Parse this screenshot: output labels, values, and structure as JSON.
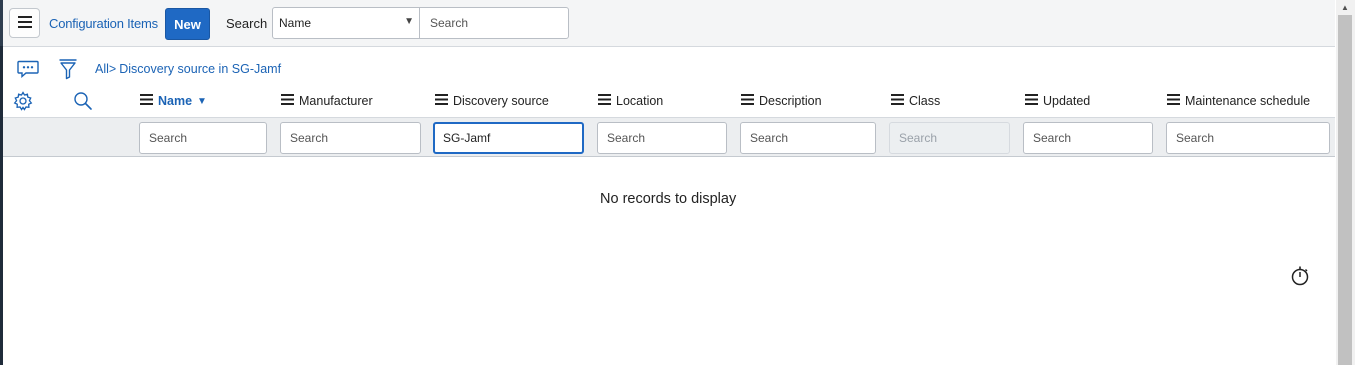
{
  "header": {
    "title": "Configuration Items",
    "new_label": "New",
    "search_label": "Search",
    "field_select_value": "Name",
    "search_placeholder": "Search"
  },
  "breadcrumb": {
    "root": "All",
    "separator": ">",
    "filter": "Discovery source in SG-Jamf"
  },
  "columns": [
    {
      "label": "Name",
      "sorted": "desc",
      "search_placeholder": "Search",
      "search_value": ""
    },
    {
      "label": "Manufacturer",
      "search_placeholder": "Search",
      "search_value": ""
    },
    {
      "label": "Discovery source",
      "search_placeholder": "Search",
      "search_value": "SG-Jamf"
    },
    {
      "label": "Location",
      "search_placeholder": "Search",
      "search_value": ""
    },
    {
      "label": "Description",
      "search_placeholder": "Search",
      "search_value": ""
    },
    {
      "label": "Class",
      "search_placeholder": "Search",
      "search_value": "",
      "disabled": true
    },
    {
      "label": "Updated",
      "search_placeholder": "Search",
      "search_value": ""
    },
    {
      "label": "Maintenance schedule",
      "search_placeholder": "Search",
      "search_value": ""
    }
  ],
  "empty_message": "No records to display",
  "icons": {
    "menu": "hamburger-icon",
    "activity": "chat-bubble-icon",
    "filter": "funnel-icon",
    "settings": "gear-icon",
    "search": "magnifier-icon",
    "response_time": "stopwatch-icon"
  },
  "colors": {
    "accent": "#1b63b5",
    "primary_button": "#1f69c4",
    "header_bg": "#f4f5f6",
    "filter_row_bg": "#eceef0"
  }
}
